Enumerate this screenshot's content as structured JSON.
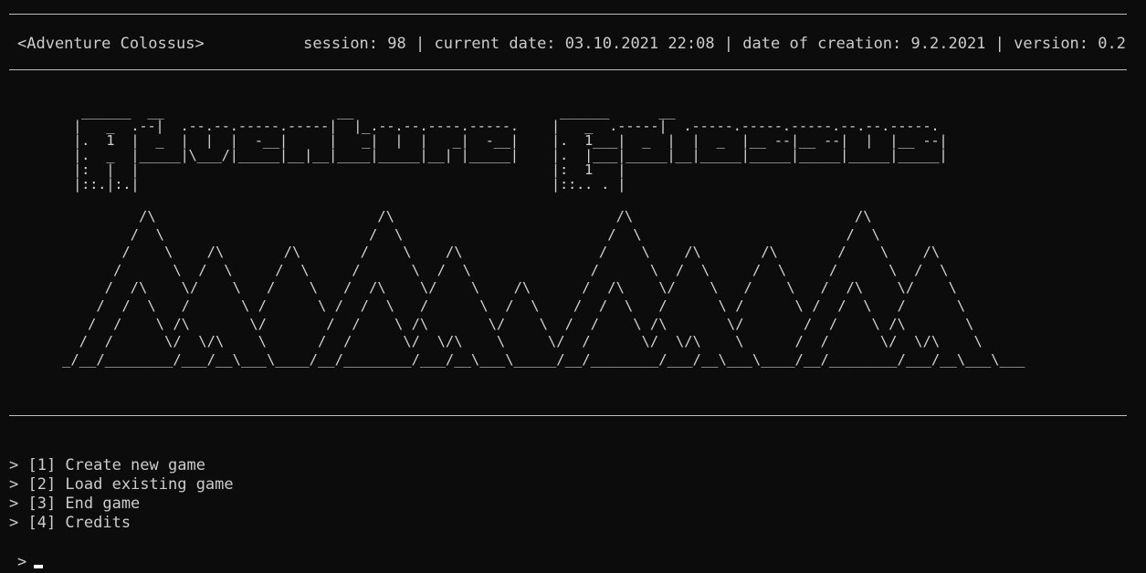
{
  "header": {
    "app_title": "<Adventure Colossus>",
    "session_label": "session:",
    "session_value": "98",
    "date_label": "current date:",
    "date_value": "03.10.2021 22:08",
    "creation_label": "date of creation:",
    "creation_value": "9.2.2021",
    "version_label": "version:",
    "version_value": "0.2",
    "separator": " | "
  },
  "title_art": "   ______  __                     __                         ______      __\n  |   _  .--|  .--.--.-----.-----|  |_.--.--.----.-----.    |   _  .-----|  .-----.-----.-----.--.--.-----.\n  |.  1  |  _  |  |  |  -__|     |   _|  |  |   _|  -__|    |.  1___|  _  |  |  _  |__ --|__ --|  |  |__ --|\n  |.  _  |_____|\\___/|_____|__|__|____|_____|__| |_____|    |.  |___|_____|__|_____|_____|_____|_____|_____|\n  |:  |  |                                                  |:  1   |\n  |::.|:.|                                                  |::.. . |",
  "mountain_art": "         /\\                          /\\                          /\\                          /\\\n        /  \\                        /  \\                        /  \\                        /  \\\n       /    \\    /\\       /\\       /    \\    /\\                /    \\    /\\       /\\       /    \\    /\\\n      /      \\  /  \\     /  \\     /      \\  /  \\              /      \\  /  \\     /  \\     /      \\  /  \\\n     /  /\\    \\/    \\   /    \\   /  /\\    \\/    \\    /\\      /  /\\    \\/    \\   /    \\   /  /\\    \\/    \\\n    /  /  \\   /      \\ /      \\ /  /  \\   /      \\  /  \\    /  /  \\   /      \\ /      \\ /  /  \\   /      \\\n   /  /    \\ /\\       \\/       /  /    \\ /\\       \\/    \\  /  /    \\ /\\       \\/       /  /    \\ /\\       \\\n  /  /      \\/  \\/\\    \\      /  /      \\/  \\/\\    \\     \\/  /      \\/  \\/\\    \\      /  /      \\/  \\/\\    \\\n_/__/________/___/__\\___\\____/__/________/___/__\\___\\_____/__/________/___/__\\___\\____/__/________/___/__\\___\\___",
  "menu": {
    "items": [
      {
        "label": "> [1] Create new game"
      },
      {
        "label": "> [2] Load existing game"
      },
      {
        "label": "> [3] End game"
      },
      {
        "label": "> [4] Credits"
      }
    ]
  },
  "prompt": {
    "symbol": ">"
  }
}
